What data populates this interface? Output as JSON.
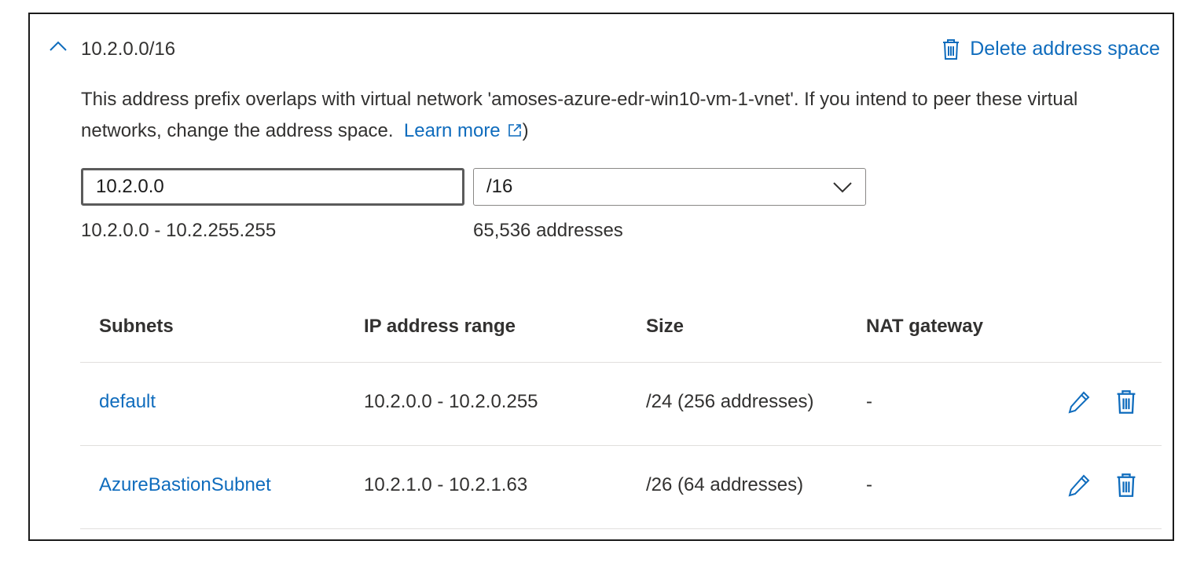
{
  "address_space": {
    "title": "10.2.0.0/16",
    "delete_label": "Delete address space",
    "warning_text": "This address prefix overlaps with virtual network 'amoses-azure-edr-win10-vm-1-vnet'. If you intend to peer these virtual networks, change the address space.",
    "learn_more": "Learn more",
    "closing_paren": ")",
    "ip_value": "10.2.0.0",
    "prefix_value": "/16",
    "range_text": "10.2.0.0 - 10.2.255.255",
    "address_count": "65,536 addresses"
  },
  "subnets": {
    "headers": [
      "Subnets",
      "IP address range",
      "Size",
      "NAT gateway"
    ],
    "rows": [
      {
        "name": "default",
        "range": "10.2.0.0 - 10.2.0.255",
        "size": "/24 (256 addresses)",
        "nat": "-"
      },
      {
        "name": "AzureBastionSubnet",
        "range": "10.2.1.0 - 10.2.1.63",
        "size": "/26 (64 addresses)",
        "nat": "-"
      }
    ]
  },
  "colors": {
    "accent": "#0f6cbd",
    "text": "#323130",
    "border": "#1b1b1b"
  },
  "icons": [
    "chevron-up-icon",
    "trash-icon",
    "external-link-icon",
    "chevron-down-icon",
    "edit-icon"
  ]
}
